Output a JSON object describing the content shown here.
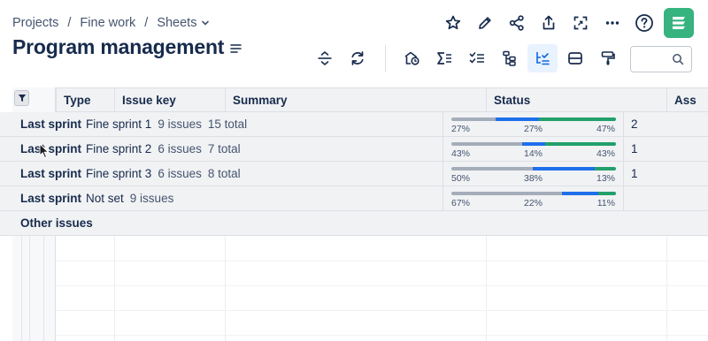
{
  "breadcrumb": {
    "items": [
      "Projects",
      "Fine work",
      "Sheets"
    ],
    "separator": "/"
  },
  "page_title": "Program management",
  "search": {
    "value": "",
    "placeholder": ""
  },
  "table": {
    "columns": [
      "Type",
      "Issue key",
      "Summary",
      "Status",
      "Ass"
    ],
    "groups": [
      {
        "type": "Last sprint",
        "name": "Fine sprint 1",
        "issues": "9 issues",
        "total": "15 total",
        "status": {
          "todo": 27,
          "in_progress": 27,
          "done": 47,
          "todo_label": "27%",
          "in_progress_label": "27%",
          "done_label": "47%"
        },
        "assignee": "2"
      },
      {
        "type": "Last sprint",
        "name": "Fine sprint 2",
        "issues": "6 issues",
        "total": "7 total",
        "status": {
          "todo": 43,
          "in_progress": 14,
          "done": 43,
          "todo_label": "43%",
          "in_progress_label": "14%",
          "done_label": "43%"
        },
        "assignee": "1"
      },
      {
        "type": "Last sprint",
        "name": "Fine sprint 3",
        "issues": "6 issues",
        "total": "8 total",
        "status": {
          "todo": 50,
          "in_progress": 38,
          "done": 13,
          "todo_label": "50%",
          "in_progress_label": "38%",
          "done_label": "13%"
        },
        "assignee": "1"
      },
      {
        "type": "Last sprint",
        "name": "Not set",
        "issues": "9 issues",
        "total": "",
        "status": {
          "todo": 67,
          "in_progress": 22,
          "done": 11,
          "todo_label": "67%",
          "in_progress_label": "22%",
          "done_label": "11%"
        },
        "assignee": ""
      },
      {
        "type": "Other issues",
        "name": "",
        "issues": "",
        "total": "",
        "status": null,
        "assignee": ""
      }
    ]
  },
  "icons": {
    "top_actions": [
      "star-icon",
      "pencil-icon",
      "share-icon",
      "export-icon",
      "fullscreen-icon",
      "more-icon",
      "help-icon",
      "app-logo"
    ],
    "toolbar": [
      "row-height-icon",
      "refresh-icon",
      "add-view-icon",
      "sum-icon",
      "checklist-icon",
      "hierarchy-icon",
      "group-by-icon",
      "rows-icon",
      "format-paint-icon"
    ]
  },
  "colors": {
    "accent": "#1f6feb",
    "status_todo": "#a5adba",
    "status_in_progress": "#1f6feb",
    "status_done": "#22a06b",
    "logo": "#36b37e",
    "active_tool_bg": "#e9f2ff"
  }
}
